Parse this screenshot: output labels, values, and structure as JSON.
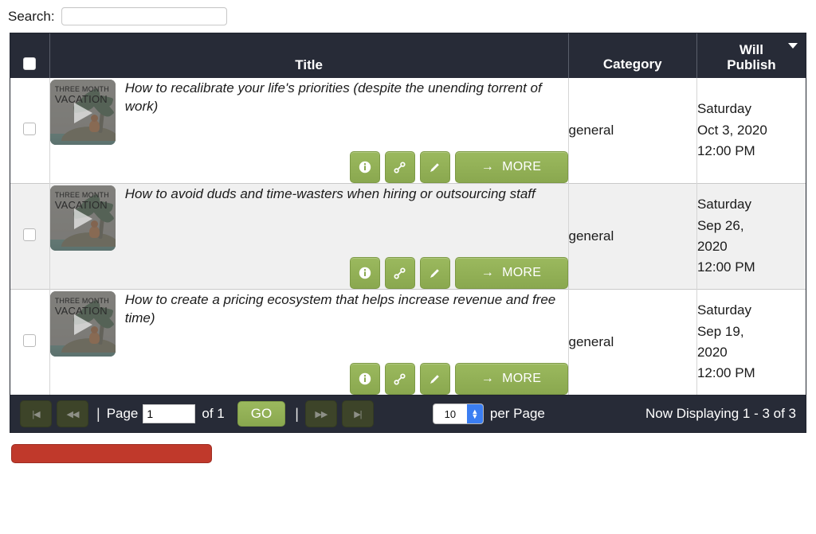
{
  "search": {
    "label": "Search:",
    "value": "",
    "placeholder": ""
  },
  "table": {
    "columns": {
      "select_all": "",
      "title": "Title",
      "category": "Category",
      "will_publish": "Will Publish",
      "will_publish_line1": "Will",
      "will_publish_line2": "Publish",
      "sort_indicator": "descending"
    },
    "rows": [
      {
        "selected": false,
        "thumbnail": {
          "line1": "THREE MONTH",
          "line2": "VACATION",
          "icon": "play-icon"
        },
        "title": "How to recalibrate your life's priorities (despite the unending torrent of work)",
        "category": "general",
        "will_publish": "Saturday Oct 3, 2020 12:00 PM",
        "will_publish_lines": [
          "Saturday",
          "Oct 3, 2020",
          "12:00 PM"
        ],
        "actions": {
          "info": "info-icon",
          "link": "link-icon",
          "edit": "pencil-icon",
          "more_label": "MORE",
          "more_arrow": "→"
        }
      },
      {
        "selected": false,
        "thumbnail": {
          "line1": "THREE MONTH",
          "line2": "VACATION",
          "icon": "play-icon"
        },
        "title": "How to avoid duds and time-wasters when hiring or outsourcing staff",
        "category": "general",
        "will_publish": "Saturday Sep 26, 2020 12:00 PM",
        "will_publish_lines": [
          "Saturday",
          "Sep 26,",
          "2020",
          "12:00 PM"
        ],
        "actions": {
          "info": "info-icon",
          "link": "link-icon",
          "edit": "pencil-icon",
          "more_label": "MORE",
          "more_arrow": "→"
        }
      },
      {
        "selected": false,
        "thumbnail": {
          "line1": "THREE MONTH",
          "line2": "VACATION",
          "icon": "play-icon"
        },
        "title": "How to create a pricing ecosystem that helps increase revenue and free time)",
        "category": "general",
        "will_publish": "Saturday Sep 19, 2020 12:00 PM",
        "will_publish_lines": [
          "Saturday",
          "Sep 19,",
          "2020",
          "12:00 PM"
        ],
        "actions": {
          "info": "info-icon",
          "link": "link-icon",
          "edit": "pencil-icon",
          "more_label": "MORE",
          "more_arrow": "→"
        }
      }
    ]
  },
  "pager": {
    "first_label": "|◀",
    "prev_label": "◀◀",
    "next_label": "▶▶",
    "last_label": "▶|",
    "divider": "|",
    "page_label": "Page",
    "page_value": "1",
    "of_label": "of 1",
    "go_label": "GO",
    "per_page_value": "10",
    "per_page_label": "per Page",
    "per_page_options": [
      "10"
    ],
    "now_displaying": "Now Displaying 1 - 3 of 3"
  },
  "bottom_action": {
    "label": "",
    "color": "#c0392b"
  }
}
